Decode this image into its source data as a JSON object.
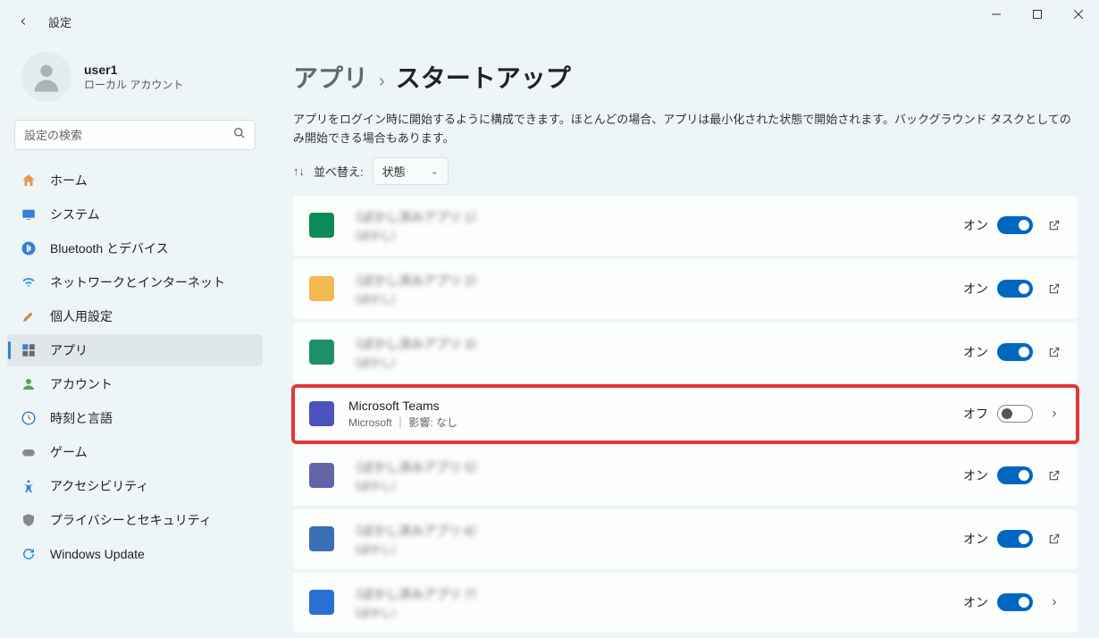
{
  "window": {
    "title": "設定"
  },
  "user": {
    "name": "user1",
    "subtitle": "ローカル アカウント"
  },
  "search": {
    "placeholder": "設定の検索"
  },
  "nav": {
    "items": [
      {
        "label": "ホーム",
        "icon": "home"
      },
      {
        "label": "システム",
        "icon": "system"
      },
      {
        "label": "Bluetooth とデバイス",
        "icon": "bluetooth"
      },
      {
        "label": "ネットワークとインターネット",
        "icon": "network"
      },
      {
        "label": "個人用設定",
        "icon": "personalize"
      },
      {
        "label": "アプリ",
        "icon": "apps"
      },
      {
        "label": "アカウント",
        "icon": "account"
      },
      {
        "label": "時刻と言語",
        "icon": "time"
      },
      {
        "label": "ゲーム",
        "icon": "gaming"
      },
      {
        "label": "アクセシビリティ",
        "icon": "accessibility"
      },
      {
        "label": "プライバシーとセキュリティ",
        "icon": "privacy"
      },
      {
        "label": "Windows Update",
        "icon": "update"
      }
    ]
  },
  "breadcrumb": {
    "parent": "アプリ",
    "current": "スタートアップ"
  },
  "description": "アプリをログイン時に開始するように構成できます。ほとんどの場合、アプリは最小化された状態で開始されます。バックグラウンド タスクとしてのみ開始できる場合もあります。",
  "sort": {
    "label": "並べ替え:",
    "value": "状態"
  },
  "toggle_labels": {
    "on": "オン",
    "off": "オフ"
  },
  "apps": [
    {
      "name": "（ぼかし済みアプリ 1）",
      "sub": "（ぼかし）",
      "state": "on",
      "icon_bg": "#0b8a5a",
      "action": "external",
      "blurred": true
    },
    {
      "name": "（ぼかし済みアプリ 2）",
      "sub": "（ぼかし）",
      "state": "on",
      "icon_bg": "#f3b84f",
      "action": "external",
      "blurred": true
    },
    {
      "name": "（ぼかし済みアプリ 3）",
      "sub": "（ぼかし）",
      "state": "on",
      "icon_bg": "#1f8f6b",
      "action": "external",
      "blurred": true
    },
    {
      "name": "Microsoft Teams",
      "sub": "Microsoft ｜ 影響: なし",
      "state": "off",
      "icon_bg": "#4b53bc",
      "action": "chevron",
      "highlighted": true
    },
    {
      "name": "（ぼかし済みアプリ 5）",
      "sub": "（ぼかし）",
      "state": "on",
      "icon_bg": "#6264a7",
      "action": "external",
      "blurred": true
    },
    {
      "name": "（ぼかし済みアプリ 6）",
      "sub": "（ぼかし）",
      "state": "on",
      "icon_bg": "#3b6fb6",
      "action": "external",
      "blurred": true
    },
    {
      "name": "（ぼかし済みアプリ 7）",
      "sub": "（ぼかし）",
      "state": "on",
      "icon_bg": "#2a6fd6",
      "action": "chevron",
      "blurred": true
    }
  ]
}
